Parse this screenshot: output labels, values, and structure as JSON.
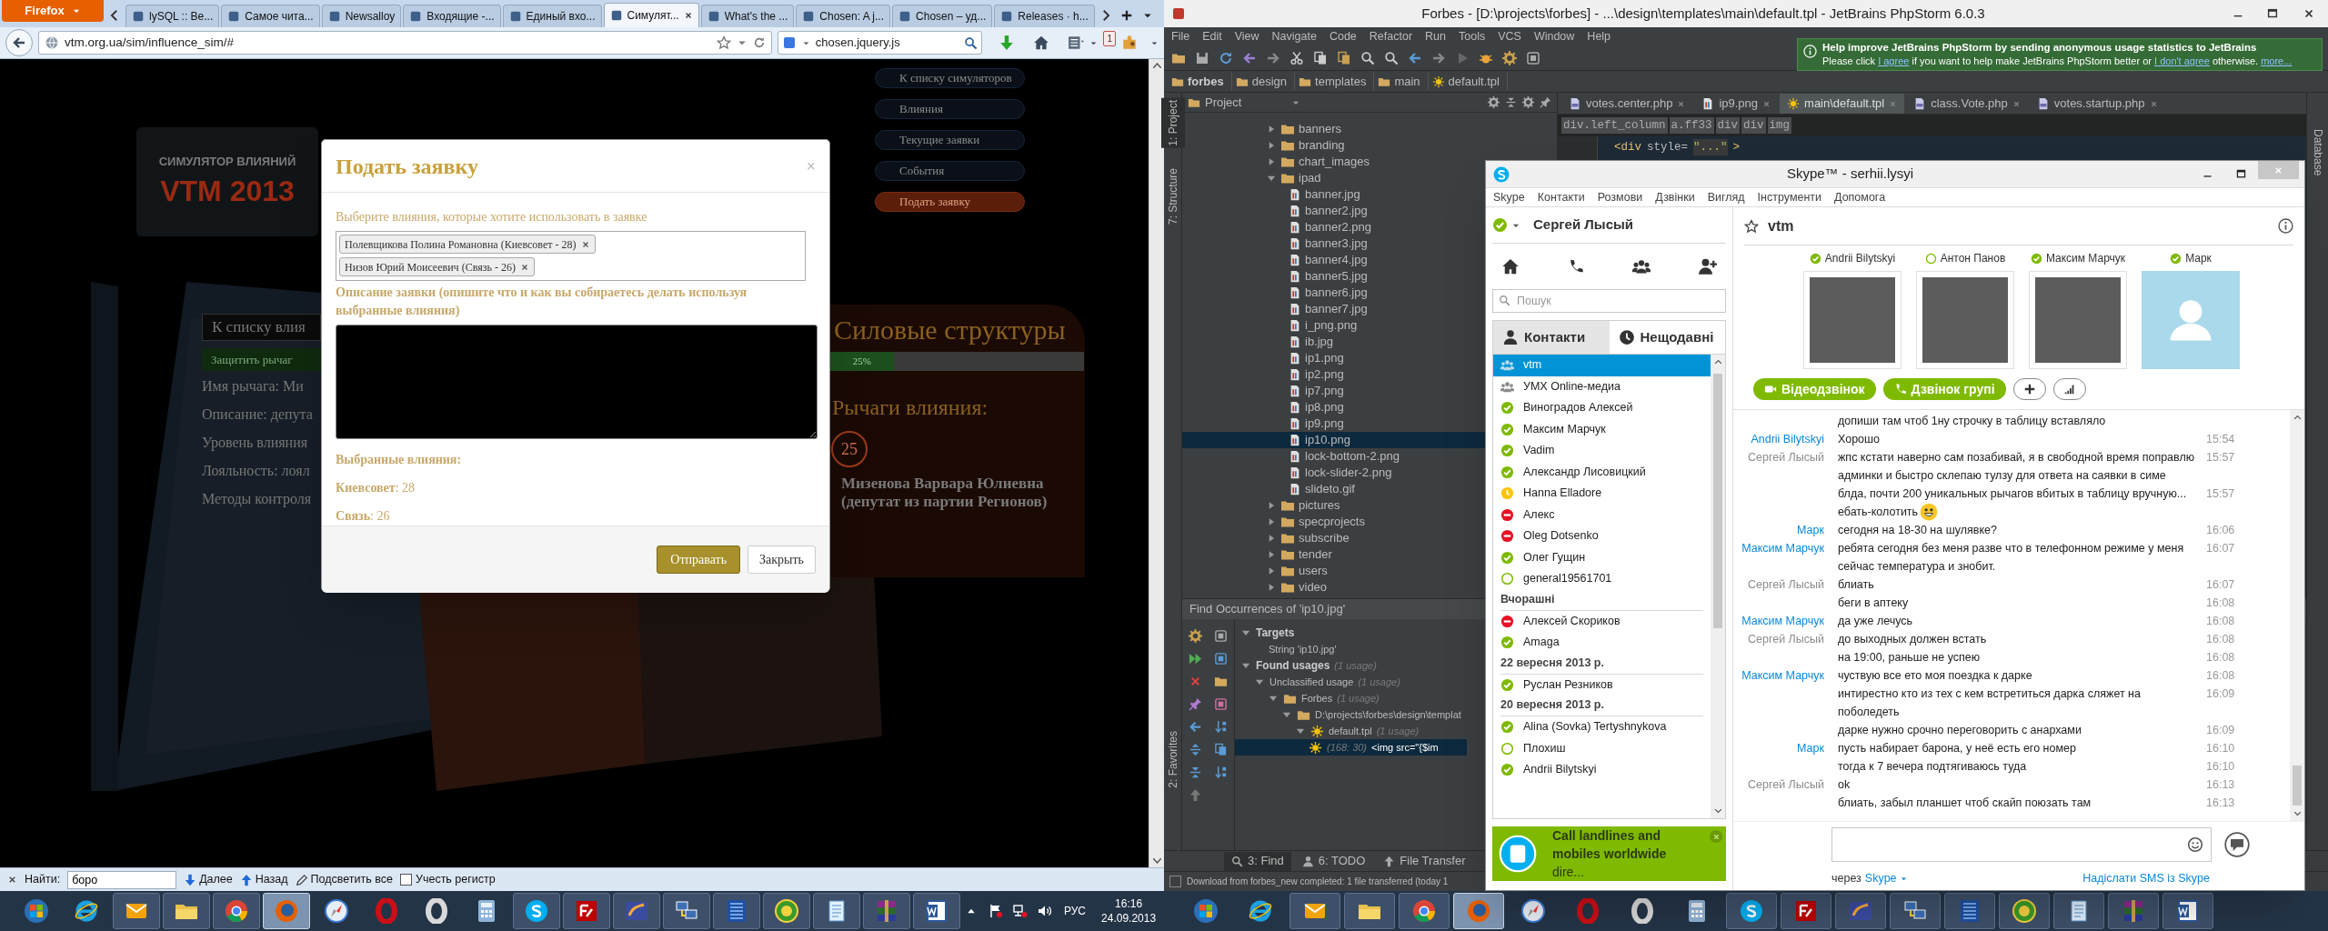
{
  "firefox": {
    "menu_button": "Firefox",
    "tabs": [
      {
        "label": "lySQL :: Be...",
        "selected": false
      },
      {
        "label": "Самое чита...",
        "selected": false
      },
      {
        "label": "Newsalloy",
        "selected": false
      },
      {
        "label": "Входящие -...",
        "selected": false
      },
      {
        "label": "Единый вхо...",
        "selected": false
      },
      {
        "label": "Симулят...",
        "selected": true
      },
      {
        "label": "What's the ...",
        "selected": false
      },
      {
        "label": "Chosen: A j...",
        "selected": false
      },
      {
        "label": "Chosen – уд...",
        "selected": false
      },
      {
        "label": "Releases · h...",
        "selected": false
      }
    ],
    "url": "vtm.org.ua/sim/influence_sim/#",
    "search": "chosen.jquery.js",
    "badge": "1",
    "find_bar": {
      "label": "Найти:",
      "value": "боро",
      "next": "Далее",
      "prev": "Назад",
      "highlight": "Подсветить все",
      "match_case": {
        "label": "Учесть регистр",
        "checked": false
      }
    }
  },
  "site": {
    "logo_top": "СИМУЛЯТОР ВЛИЯНИЙ",
    "logo_main": "VTM 2013",
    "nav": [
      {
        "label": "К списку симуляторов",
        "selected": false
      },
      {
        "label": "Влияния",
        "selected": false
      },
      {
        "label": "Текущие заявки",
        "selected": false
      },
      {
        "label": "События",
        "selected": false
      },
      {
        "label": "Подать заявку",
        "selected": true
      }
    ],
    "lever_field": "К списку влия",
    "protect_button": "Защитить рычаг",
    "details": [
      "Имя рычага: Ми",
      "Описание: депута",
      "Уровень влияния",
      "Лояльность: лоял",
      "Методы контроля"
    ],
    "group_title": "Силовые структуры",
    "progress": {
      "level": 0.25,
      "label": "25%"
    },
    "levers_title": "Рычаги влияния:",
    "lever": {
      "number": "25",
      "name": "Мизенова Варвара Юлиевна (депутат из партии Регионов)"
    }
  },
  "modal": {
    "title": "Подать заявку",
    "close": "×",
    "select_label": "Выберите влияния, которые хотите использовать в заявке",
    "chips": [
      "Полевщикова Полина Романовна (Киевсовет - 28)",
      "Низов Юрий Моисеевич (Связь - 26)"
    ],
    "description_label": "Описание заявки (опишите что и как вы собираетесь делать используя выбранные влияния)",
    "selected_title": "Выбранные влияния:",
    "selected": [
      "**Киевсовет**: 28",
      "**Связь**: 26"
    ],
    "buttons": [
      {
        "label": "Отправать",
        "kind": "primary"
      },
      {
        "label": "Закрыть",
        "kind": "default"
      }
    ]
  },
  "phpstorm": {
    "title": "Forbes - [D:\\projects\\forbes] - ...\\design\\templates\\main\\default.tpl - JetBrains PhpStorm 6.0.3",
    "menu": [
      "File",
      "Edit",
      "View",
      "Navigate",
      "Code",
      "Refactor",
      "Run",
      "Tools",
      "VCS",
      "Window",
      "Help"
    ],
    "notice": {
      "title": "Help improve JetBrains PhpStorm by sending anonymous usage statistics to JetBrains",
      "parts": [
        {
          "text": "Please click",
          "link": false
        },
        {
          "text": "I agree",
          "link": true
        },
        {
          "text": "if you want to help make JetBrains PhpStorm better or",
          "link": false
        },
        {
          "text": "I don't agree",
          "link": true
        },
        {
          "text": "otherwise.",
          "link": false
        },
        {
          "text": "more...",
          "link": true
        }
      ]
    },
    "breadcrumbs": [
      {
        "label": "forbes",
        "kind": "root"
      },
      {
        "label": "design",
        "kind": "folder"
      },
      {
        "label": "templates",
        "kind": "folder"
      },
      {
        "label": "main",
        "kind": "folder"
      },
      {
        "label": "default.tpl",
        "kind": "template"
      }
    ],
    "side_tabs": [
      {
        "label": "1: Project",
        "selected": true
      },
      {
        "label": "7: Structure",
        "selected": false
      },
      {
        "label": "2: Favorites",
        "selected": false
      }
    ],
    "right_side_tab": "Database",
    "project_header": "Project",
    "tree": [
      {
        "name": "banners",
        "kind": "folder",
        "expanded": false,
        "selected": false
      },
      {
        "name": "branding",
        "kind": "folder",
        "expanded": false,
        "selected": false
      },
      {
        "name": "chart_images",
        "kind": "folder",
        "expanded": false,
        "selected": false
      },
      {
        "name": "ipad",
        "kind": "folder",
        "expanded": true,
        "selected": false,
        "children": [
          {
            "name": "banner.jpg",
            "kind": "file",
            "selected": false
          },
          {
            "name": "banner2.jpg",
            "kind": "file",
            "selected": false
          },
          {
            "name": "banner2.png",
            "kind": "file",
            "selected": false
          },
          {
            "name": "banner3.jpg",
            "kind": "file",
            "selected": false
          },
          {
            "name": "banner4.jpg",
            "kind": "file",
            "selected": false
          },
          {
            "name": "banner5.jpg",
            "kind": "file",
            "selected": false
          },
          {
            "name": "banner6.jpg",
            "kind": "file",
            "selected": false
          },
          {
            "name": "banner7.jpg",
            "kind": "file",
            "selected": false
          },
          {
            "name": "i_png.png",
            "kind": "file",
            "selected": false
          },
          {
            "name": "ib.jpg",
            "kind": "file",
            "selected": false
          },
          {
            "name": "ip1.png",
            "kind": "file",
            "selected": false
          },
          {
            "name": "ip2.png",
            "kind": "file",
            "selected": false
          },
          {
            "name": "ip7.png",
            "kind": "file",
            "selected": false
          },
          {
            "name": "ip8.png",
            "kind": "file",
            "selected": false
          },
          {
            "name": "ip9.png",
            "kind": "file",
            "selected": false
          },
          {
            "name": "ip10.png",
            "kind": "file",
            "selected": true
          },
          {
            "name": "lock-bottom-2.png",
            "kind": "file",
            "selected": false
          },
          {
            "name": "lock-slider-2.png",
            "kind": "file",
            "selected": false
          },
          {
            "name": "slideto.gif",
            "kind": "file",
            "selected": false
          }
        ]
      },
      {
        "name": "pictures",
        "kind": "folder",
        "expanded": false,
        "selected": false
      },
      {
        "name": "specprojects",
        "kind": "folder",
        "expanded": false,
        "selected": false
      },
      {
        "name": "subscribe",
        "kind": "folder",
        "expanded": false,
        "selected": false
      },
      {
        "name": "tender",
        "kind": "folder",
        "expanded": false,
        "selected": false
      },
      {
        "name": "users",
        "kind": "folder",
        "expanded": false,
        "selected": false
      },
      {
        "name": "video",
        "kind": "folder",
        "expanded": false,
        "selected": false
      }
    ],
    "editor_tabs": [
      {
        "label": "votes.center.php",
        "kind": "php",
        "selected": false
      },
      {
        "label": "ip9.png",
        "kind": "image",
        "selected": false
      },
      {
        "label": "main\\default.tpl",
        "kind": "template",
        "selected": true
      },
      {
        "label": "class.Vote.php",
        "kind": "php",
        "selected": false
      },
      {
        "label": "votes.startup.php",
        "kind": "php",
        "selected": false
      }
    ],
    "tag_path": [
      "div.left_column",
      "a.ff33",
      "div",
      "div",
      "img"
    ],
    "code": [
      {
        "text": "<div",
        "kind": "tag"
      },
      {
        "text": "style=",
        "kind": "attr"
      },
      {
        "text": "\"...\"",
        "kind": "string"
      },
      {
        "text": ">",
        "kind": "tag"
      }
    ],
    "find": {
      "title": "Find Occurrences of 'ip10.jpg'",
      "tree": [
        {
          "label": "Targets",
          "kind": "group",
          "expanded": true,
          "selected": false,
          "children": [
            {
              "label": "String 'ip10.jpg'",
              "kind": "text",
              "selected": false
            }
          ]
        },
        {
          "label": "Found usages",
          "count": "(1 usage)",
          "kind": "group",
          "expanded": true,
          "selected": false,
          "children": [
            {
              "label": "Unclassified usage",
              "count": "(1 usage)",
              "kind": "category",
              "expanded": true,
              "selected": false,
              "children": [
                {
                  "label": "Forbes",
                  "count": "(1 usage)",
                  "kind": "module",
                  "expanded": true,
                  "selected": false,
                  "children": [
                    {
                      "label": "D:\\projects\\forbes\\design\\templat",
                      "kind": "folder",
                      "expanded": true,
                      "selected": false,
                      "children": [
                        {
                          "label": "default.tpl",
                          "count": "(1 usage)",
                          "kind": "template",
                          "expanded": true,
                          "selected": false,
                          "children": [
                            {
                              "label": "<img src=\"{$im",
                              "count": "(168: 30)",
                              "kind": "usage",
                              "selected": true
                            }
                          ]
                        }
                      ]
                    }
                  ]
                }
              ]
            }
          ]
        }
      ]
    },
    "tool_tabs": [
      {
        "label": "3: Find",
        "kind": "find",
        "selected": true
      },
      {
        "label": "6: TODO",
        "kind": "todo",
        "selected": false
      },
      {
        "label": "File Transfer",
        "kind": "transfer",
        "selected": false
      }
    ],
    "status": "Download from forbes_new completed: 1 file transferred (today 1"
  },
  "skype": {
    "title": "Skype™ - serhii.lysyi",
    "menu": [
      "Skype",
      "Контакти",
      "Розмови",
      "Дзвінки",
      "Вигляд",
      "Інструменти",
      "Допомога"
    ],
    "user": {
      "name": "Сергей Лысый",
      "kind": "online"
    },
    "search_placeholder": "Пошук",
    "tabs": [
      {
        "label": "Контакти",
        "kind": "contacts",
        "selected": false
      },
      {
        "label": "Нещодавні",
        "kind": "recent",
        "selected": true
      }
    ],
    "recent": [
      {
        "kind": "group",
        "name": "vtm",
        "selected": true
      },
      {
        "kind": "group",
        "name": "УМХ Online-медиа",
        "selected": false
      },
      {
        "kind": "online",
        "name": "Виноградов Алексей",
        "selected": false
      },
      {
        "kind": "online",
        "name": "Максим Марчук",
        "selected": false
      },
      {
        "kind": "online",
        "name": "Vadim",
        "selected": false
      },
      {
        "kind": "online",
        "name": "Александр Лисовицкий",
        "selected": false
      },
      {
        "kind": "away",
        "name": "Hanna Elladore",
        "selected": false
      },
      {
        "kind": "busy",
        "name": "Алекс",
        "selected": false
      },
      {
        "kind": "busy",
        "name": "Oleg Dotsenko",
        "selected": false
      },
      {
        "kind": "online",
        "name": "Олег Гущин",
        "selected": false
      },
      {
        "kind": "offline",
        "name": "general19561701",
        "selected": false
      },
      {
        "kind": "header",
        "name": "Вчорашні"
      },
      {
        "kind": "busy",
        "name": "Алексей Скориков",
        "selected": false
      },
      {
        "kind": "online",
        "name": "Amaga",
        "selected": false
      },
      {
        "kind": "header",
        "name": "22 вересня 2013 р."
      },
      {
        "kind": "online",
        "name": "Руслан Резников",
        "selected": false
      },
      {
        "kind": "header",
        "name": "20 вересня 2013 р."
      },
      {
        "kind": "online",
        "name": "Alina (Sovka) Tertyshnykova",
        "selected": false
      },
      {
        "kind": "offline",
        "name": "Плохиш",
        "selected": false
      },
      {
        "kind": "online",
        "name": "Andrii Bilytskyi",
        "selected": false
      }
    ],
    "ad": "**Call landlines and mobiles worldwide** dire...",
    "chat": {
      "title": "vtm",
      "participants": [
        {
          "name": "Andrii Bilytskyi",
          "kind": "online",
          "photo": true
        },
        {
          "name": "Антон Панов",
          "kind": "offline",
          "photo": true
        },
        {
          "name": "Максим Марчук",
          "kind": "online",
          "photo": true
        },
        {
          "name": "Марк",
          "kind": "online",
          "photo": false
        }
      ],
      "buttons": [
        {
          "label": "Відеодзвінок",
          "kind": "video"
        },
        {
          "label": "Дзвінок групі",
          "kind": "call"
        },
        {
          "kind": "add"
        },
        {
          "kind": "quality"
        }
      ],
      "messages": [
        {
          "text": "допиши там чтоб 1ну строчку в таблицу вставляло"
        },
        {
          "sender": "Andrii Bilytskyi",
          "self": false,
          "text": "Хорошо",
          "time": "15:54"
        },
        {
          "sender": "Сергей Лысый",
          "self": true,
          "text": "жпс кстати наверно сам позабивай, я в свободной время поправлю админки и быстро склепаю тулзу для ответа на саявки в симе",
          "time": "15:57"
        },
        {
          "text": "блда, почти 200 уникальных рычагов вбитых в таблицу вручную...",
          "time": "15:57"
        },
        {
          "text": "ебать-колотить",
          "emoticon": true
        },
        {
          "sender": "Марк",
          "self": false,
          "text": "сегодня на 18-30 на шулявке?",
          "time": "16:06"
        },
        {
          "sender": "Максим Марчук",
          "self": false,
          "text": "ребята сегодня без меня разве что в телефонном режиме у меня сейчас температура и знобит.",
          "time": "16:07"
        },
        {
          "sender": "Сергей Лысый",
          "self": true,
          "text": "блиать",
          "time": "16:07"
        },
        {
          "text": "беги в аптеку",
          "time": "16:08"
        },
        {
          "sender": "Максим Марчук",
          "self": false,
          "text": "да уже лечусь",
          "time": "16:08"
        },
        {
          "sender": "Сергей Лысый",
          "self": true,
          "text": "до выходных должен встать",
          "time": "16:08"
        },
        {
          "text": "на 19:00, раньше не успею",
          "time": "16:08"
        },
        {
          "sender": "Максим Марчук",
          "self": false,
          "text": "чуствую все ето моя поездка к дарке",
          "time": "16:08"
        },
        {
          "text": "интирестно кто из тех с кем встретиться дарка сляжет на поболедеть",
          "time": "16:09"
        },
        {
          "text": "дарке нужно срочно переговорить с анархами",
          "time": "16:09"
        },
        {
          "sender": "Марк",
          "self": false,
          "text": "пусть набирает барона, у неё есть его номер",
          "time": "16:10"
        },
        {
          "text": "тогда к 7 вечера подтягиваюсь туда",
          "time": "16:10"
        },
        {
          "sender": "Сергей Лысый",
          "self": true,
          "text": "ok",
          "time": "16:13"
        },
        {
          "text": "блиать, забыл планшет чтоб скайп поюзать там",
          "time": "16:13"
        }
      ],
      "via_label": "через",
      "via_link": "Skype",
      "sms_link": "Надіслати SMS із Skype"
    }
  },
  "taskbar_left": {
    "apps": [
      {
        "kind": "start",
        "open": false,
        "selected": false
      },
      {
        "kind": "ie",
        "open": false,
        "selected": false
      },
      {
        "kind": "mail",
        "open": true,
        "selected": false
      },
      {
        "kind": "explorer",
        "open": true,
        "selected": false
      },
      {
        "kind": "chrome",
        "open": true,
        "selected": false
      },
      {
        "kind": "firefox",
        "open": true,
        "selected": true
      },
      {
        "kind": "safari",
        "open": false,
        "selected": false
      },
      {
        "kind": "opera",
        "open": false,
        "selected": false
      },
      {
        "kind": "opera_next",
        "open": false,
        "selected": false
      },
      {
        "kind": "calc",
        "open": false,
        "selected": false
      },
      {
        "kind": "skype",
        "open": true,
        "selected": false
      },
      {
        "kind": "ftp",
        "open": true,
        "selected": false
      },
      {
        "kind": "ide",
        "open": true,
        "selected": false
      },
      {
        "kind": "network",
        "open": true,
        "selected": false
      },
      {
        "kind": "server",
        "open": true,
        "selected": false
      },
      {
        "kind": "hs",
        "open": true,
        "selected": false
      },
      {
        "kind": "notepad",
        "open": true,
        "selected": false
      },
      {
        "kind": "archive",
        "open": true,
        "selected": false
      },
      {
        "kind": "word",
        "open": true,
        "selected": false
      }
    ],
    "tray": {
      "language": "РУС",
      "time": "16:16",
      "date": "24.09.2013"
    }
  },
  "taskbar_right": {
    "apps": [
      {
        "kind": "start",
        "open": false,
        "selected": false
      },
      {
        "kind": "ie",
        "open": false,
        "selected": false
      },
      {
        "kind": "mail",
        "open": true,
        "selected": false
      },
      {
        "kind": "explorer",
        "open": true,
        "selected": false
      },
      {
        "kind": "chrome",
        "open": true,
        "selected": false
      },
      {
        "kind": "firefox",
        "open": true,
        "selected": true
      },
      {
        "kind": "safari",
        "open": false,
        "selected": false
      },
      {
        "kind": "opera",
        "open": false,
        "selected": false
      },
      {
        "kind": "opera_next",
        "open": false,
        "selected": false
      },
      {
        "kind": "calc",
        "open": false,
        "selected": false
      },
      {
        "kind": "skype",
        "open": true,
        "selected": false
      },
      {
        "kind": "ftp",
        "open": true,
        "selected": false
      },
      {
        "kind": "ide",
        "open": true,
        "selected": false
      },
      {
        "kind": "network",
        "open": true,
        "selected": false
      },
      {
        "kind": "server",
        "open": true,
        "selected": false
      },
      {
        "kind": "hs",
        "open": true,
        "selected": false
      },
      {
        "kind": "notepad",
        "open": true,
        "selected": false
      },
      {
        "kind": "archive",
        "open": true,
        "selected": false
      },
      {
        "kind": "word",
        "open": true,
        "selected": false
      }
    ]
  }
}
